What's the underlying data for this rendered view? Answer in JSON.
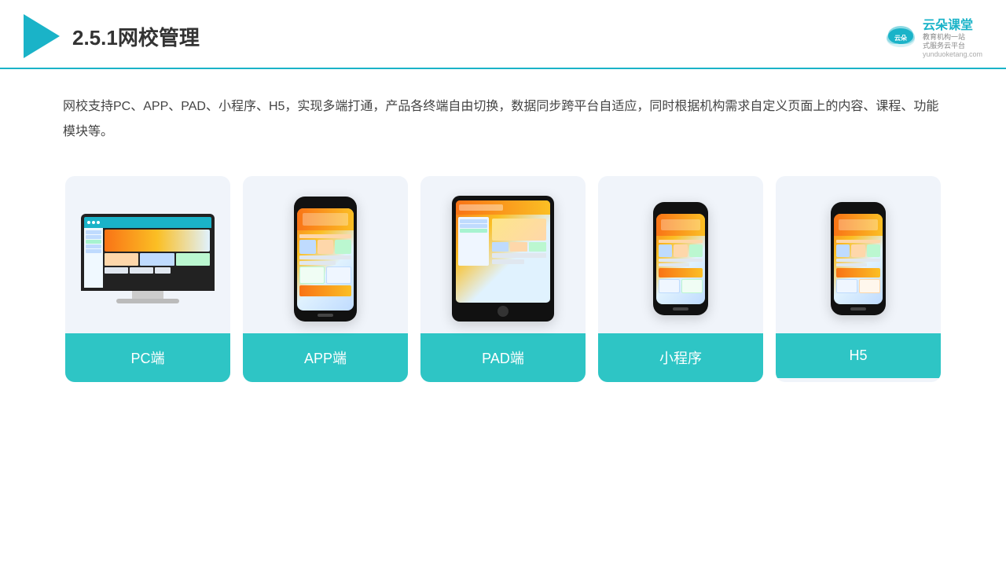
{
  "header": {
    "title": "2.5.1网校管理",
    "brand_name": "云朵课堂",
    "brand_slogan_line1": "教育机构一站",
    "brand_slogan_line2": "式服务云平台",
    "brand_url": "yunduoketang.com"
  },
  "description": {
    "text": "网校支持PC、APP、PAD、小程序、H5，实现多端打通，产品各终端自由切换，数据同步跨平台自适应，同时根据机构需求自定义页面上的内容、课程、功能模块等。"
  },
  "cards": [
    {
      "label": "PC端",
      "type": "pc"
    },
    {
      "label": "APP端",
      "type": "phone"
    },
    {
      "label": "PAD端",
      "type": "tablet"
    },
    {
      "label": "小程序",
      "type": "phone_mini"
    },
    {
      "label": "H5",
      "type": "phone_mini2"
    }
  ]
}
